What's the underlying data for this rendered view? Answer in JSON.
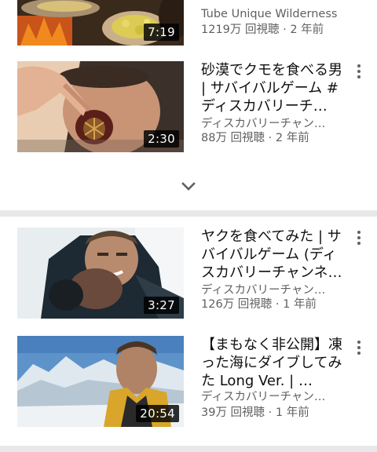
{
  "videos": [
    {
      "title": "",
      "channel": "Tube Unique Wilderness",
      "meta": "1219万 回視聴 · 2 年前",
      "duration": "7:19"
    },
    {
      "title": "砂漠でクモを食べる男 | サバイバルゲーム #ディスカバリーチ…",
      "channel": "ディスカバリーチャン…",
      "meta": "88万 回視聴 · 2 年前",
      "duration": "2:30"
    },
    {
      "title": "ヤクを食べてみた | サバイバルゲーム (ディスカバリーチャンネ…",
      "channel": "ディスカバリーチャン…",
      "meta": "126万 回視聴 · 1 年前",
      "duration": "3:27"
    },
    {
      "title": "【まもなく非公開】凍った海にダイブしてみた Long Ver. | …",
      "channel": "ディスカバリーチャン…",
      "meta": "39万 回視聴 · 1 年前",
      "duration": "20:54"
    }
  ],
  "icons": {
    "expand": "chevron-down-icon",
    "menu": "more-vert-icon"
  }
}
